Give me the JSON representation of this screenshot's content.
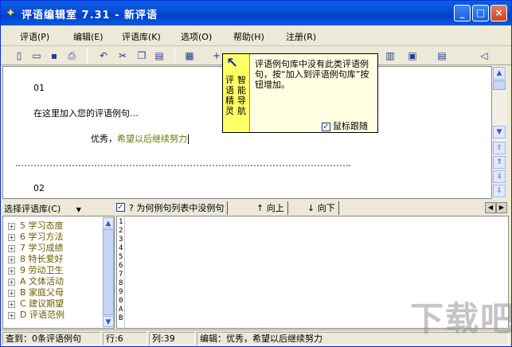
{
  "window": {
    "title": "评语编辑室 7.31 - 新评语",
    "buttons": {
      "minimize": "_",
      "maximize": "□",
      "close": "×"
    }
  },
  "menu": [
    {
      "label": "评语(P)"
    },
    {
      "label": "编辑(E)"
    },
    {
      "label": "评语库(K)"
    },
    {
      "label": "选项(O)"
    },
    {
      "label": "帮助(H)"
    },
    {
      "label": "注册(R)"
    }
  ],
  "toolbar": {
    "icons": [
      "new-file-icon",
      "open-folder-icon",
      "save-icon",
      "print-icon",
      "undo-icon",
      "cut-icon",
      "copy-icon",
      "paste-icon",
      "wizard-icon",
      "add-icon",
      "grid-icon",
      "table-icon",
      "settings-icon",
      "speaker-icon"
    ]
  },
  "editor": {
    "line1_number": "01",
    "placeholder_line": "在这里加入您的评语例句…",
    "comment_prefix": "优秀，",
    "comment_text": "希望以后继续努力",
    "line2_number": "02"
  },
  "wizard": {
    "side_col1": "评语精灵",
    "side_col2": "智能导航",
    "message": "评语例句库中没有此类评语例句，按“加入到评语例句库”按钮增加。",
    "follow_mouse_label": "鼠标跟随",
    "follow_mouse_checked": true
  },
  "library": {
    "select_label": "选择评语库(C)",
    "items": [
      {
        "label": "5 学习态度"
      },
      {
        "label": "6 学习方法"
      },
      {
        "label": "7 学习成绩"
      },
      {
        "label": "8 特长爱好"
      },
      {
        "label": "9 劳动卫生"
      },
      {
        "label": "A 文体活动"
      },
      {
        "label": "B 家庭父母"
      },
      {
        "label": "C 建议期望"
      },
      {
        "label": "D 评语范例"
      }
    ]
  },
  "list_tabs": {
    "help_tab": "?  为何例句列表中没例句",
    "up_tab": "向上",
    "down_tab": "向下"
  },
  "line_numbers": [
    "1",
    "2",
    "3",
    "4",
    "5",
    "6",
    "7",
    "8",
    "9",
    "0",
    "A",
    "B"
  ],
  "status": {
    "found": "查到：0条评语例句",
    "row": "行:6",
    "col": "列:39",
    "edit": "编辑：优秀，希望以后继续努力"
  },
  "colors": {
    "titlebar": "#0a4fd6",
    "wizard_side": "#ffff66",
    "wizard_body": "#ffffe1",
    "comment_green": "#6b7a00"
  }
}
